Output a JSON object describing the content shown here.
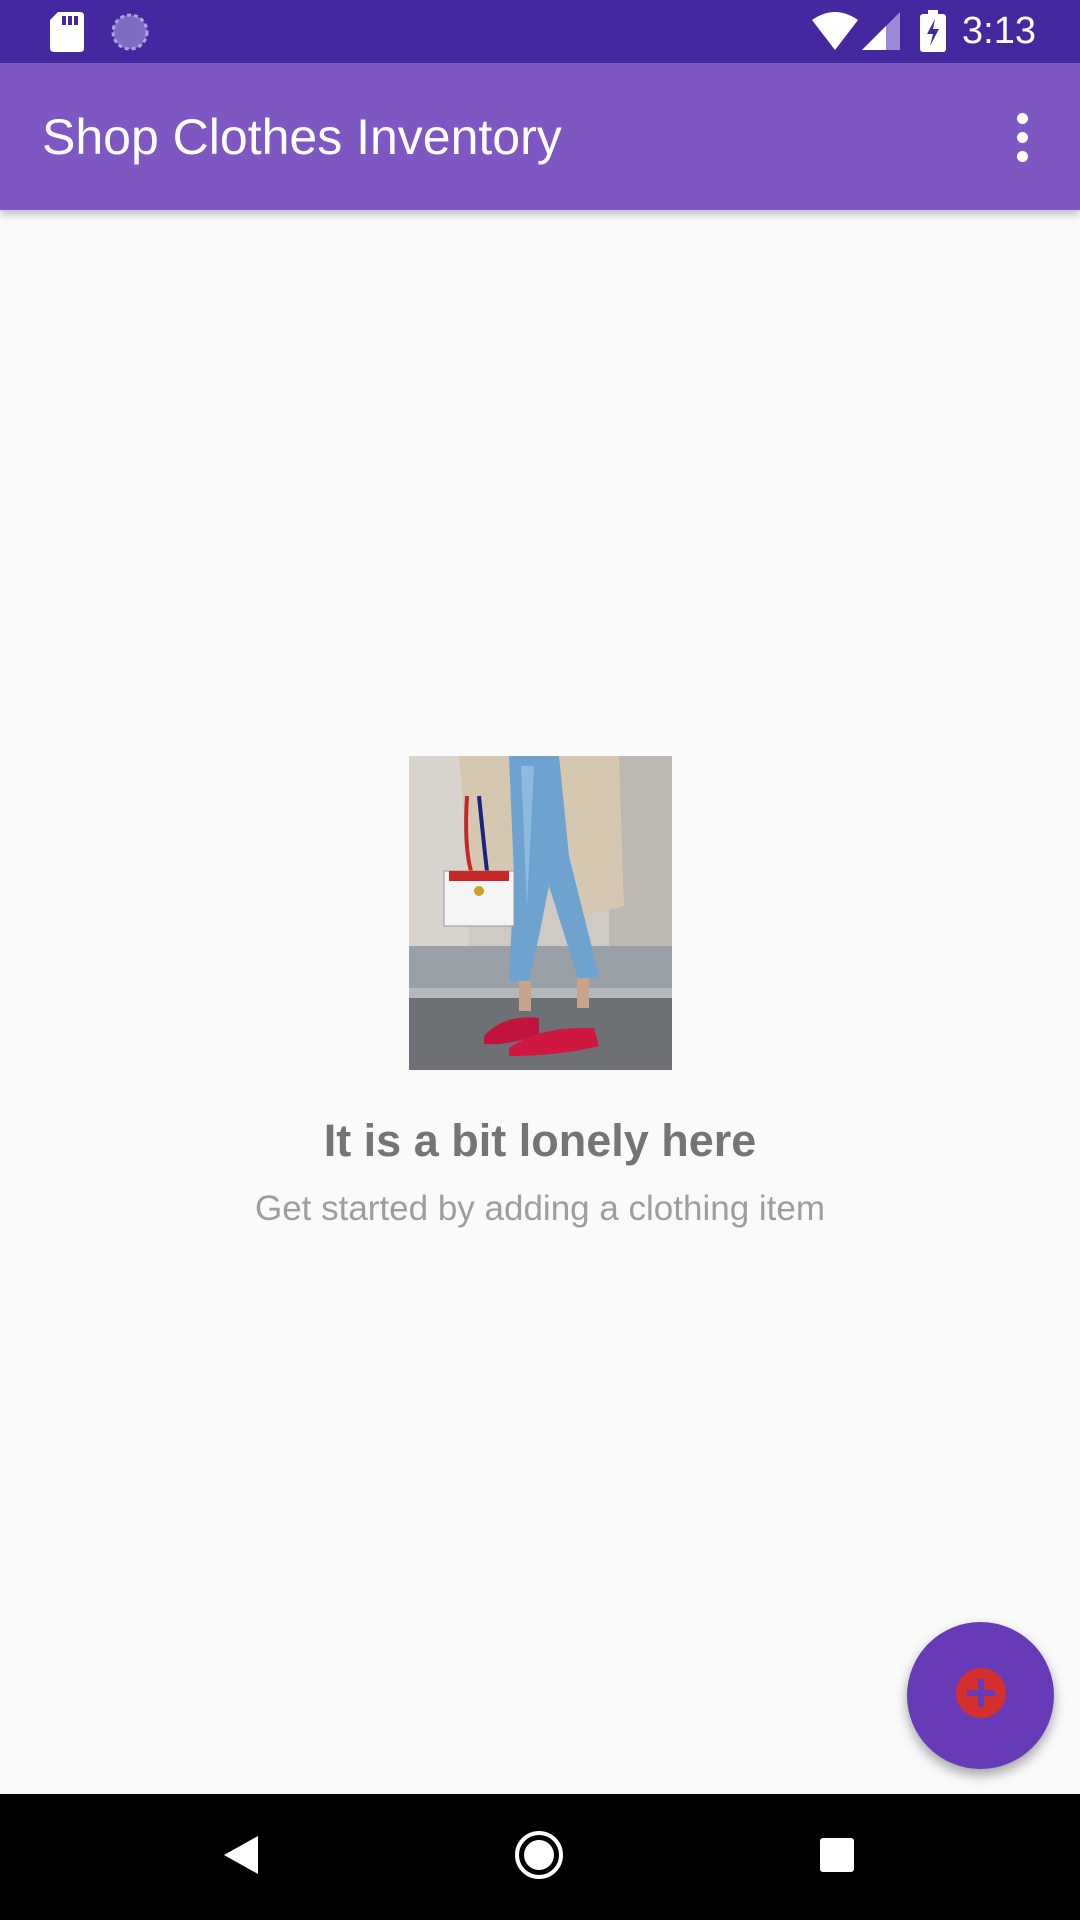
{
  "status_bar": {
    "time": "3:13",
    "icons": [
      "sd-card-icon",
      "sync-icon",
      "wifi-icon",
      "signal-icon",
      "battery-charging-icon"
    ]
  },
  "app_bar": {
    "title": "Shop Clothes Inventory",
    "overflow_icon": "more-vert-icon"
  },
  "empty_state": {
    "image_icon": "fashion-photo",
    "title": "It is a bit lonely here",
    "subtitle": "Get started by adding a clothing item"
  },
  "fab": {
    "icon": "add-circle-icon"
  },
  "nav_bar": {
    "icons": [
      "back-icon",
      "home-icon",
      "recents-icon"
    ]
  },
  "colors": {
    "status_bar": "#4527a0",
    "app_bar": "#7e57c2",
    "fab": "#673ab7",
    "fab_icon": "#d32f2f",
    "background": "#fafafa"
  }
}
